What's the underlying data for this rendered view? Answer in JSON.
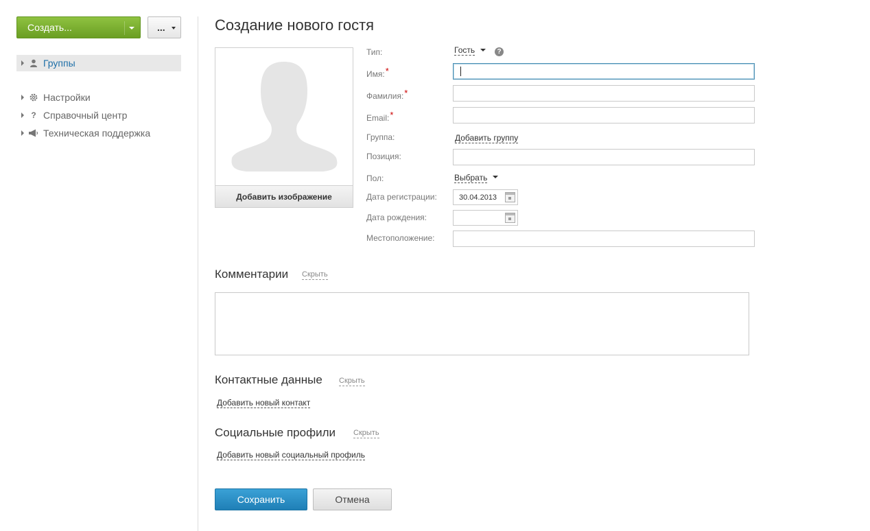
{
  "sidebar": {
    "create_label": "Создать...",
    "more_label": "...",
    "items": [
      {
        "label": "Группы",
        "icon": "user-icon"
      },
      {
        "label": "Настройки",
        "icon": "gear-icon"
      },
      {
        "label": "Справочный центр",
        "icon": "question-icon"
      },
      {
        "label": "Техническая поддержка",
        "icon": "megaphone-icon"
      }
    ]
  },
  "main": {
    "title": "Создание нового гостя",
    "photo": {
      "add_label": "Добавить изображение"
    },
    "form": {
      "type_label": "Тип:",
      "type_value": "Гость",
      "help_glyph": "?",
      "first_name_label": "Имя:",
      "last_name_label": "Фамилия:",
      "email_label": "Email:",
      "required_mark": "*",
      "group_label": "Группа:",
      "group_link": "Добавить группу",
      "position_label": "Позиция:",
      "gender_label": "Пол:",
      "gender_value": "Выбрать",
      "reg_date_label": "Дата регистрации:",
      "reg_date_value": "30.04.2013",
      "birth_date_label": "Дата рождения:",
      "birth_date_value": "",
      "location_label": "Местоположение:"
    },
    "comments": {
      "title": "Комментарии",
      "hide": "Скрыть"
    },
    "contacts": {
      "title": "Контактные данные",
      "hide": "Скрыть",
      "add_link": "Добавить новый контакт"
    },
    "social": {
      "title": "Социальные профили",
      "hide": "Скрыть",
      "add_link": "Добавить новый социальный профиль"
    },
    "save_label": "Сохранить",
    "cancel_label": "Отмена"
  },
  "colors": {
    "accent_green": "#7cb331",
    "accent_blue": "#2a8fc6",
    "link_active": "#1e6fa8",
    "required": "#cc0000"
  }
}
